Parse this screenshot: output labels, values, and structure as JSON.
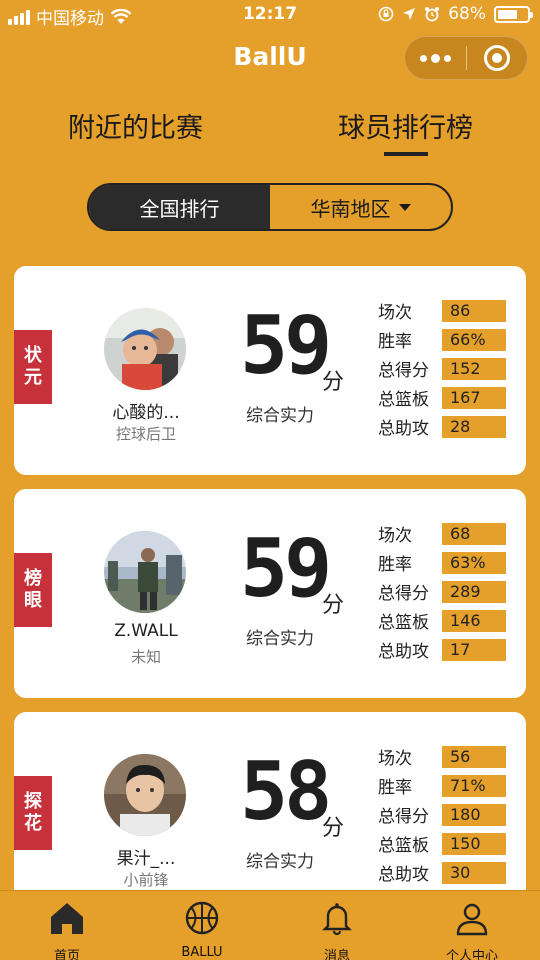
{
  "status_bar": {
    "carrier": "中国移动",
    "time": "12:17",
    "battery_percent": "68%",
    "battery_level": 0.68
  },
  "nav": {
    "title": "BallU"
  },
  "tabs": [
    {
      "label": "附近的比赛",
      "active": false
    },
    {
      "label": "球员排行榜",
      "active": true
    }
  ],
  "segment": {
    "national": "全国排行",
    "region": "华南地区"
  },
  "players": [
    {
      "ribbon": [
        "状",
        "元"
      ],
      "name": "心酸的...",
      "position": "控球后卫",
      "score": "59",
      "unit": "分",
      "score_label": "综合实力",
      "stats": [
        {
          "label": "场次",
          "value": "86"
        },
        {
          "label": "胜率",
          "value": "66%"
        },
        {
          "label": "总得分",
          "value": "152"
        },
        {
          "label": "总篮板",
          "value": "167"
        },
        {
          "label": "总助攻",
          "value": "28"
        }
      ]
    },
    {
      "ribbon": [
        "榜",
        "眼"
      ],
      "name": "Z.WALL",
      "position": "未知",
      "score": "59",
      "unit": "分",
      "score_label": "综合实力",
      "stats": [
        {
          "label": "场次",
          "value": "68"
        },
        {
          "label": "胜率",
          "value": "63%"
        },
        {
          "label": "总得分",
          "value": "289"
        },
        {
          "label": "总篮板",
          "value": "146"
        },
        {
          "label": "总助攻",
          "value": "17"
        }
      ]
    },
    {
      "ribbon": [
        "探",
        "花"
      ],
      "name": "果汁_...",
      "position": "小前锋",
      "score": "58",
      "unit": "分",
      "score_label": "综合实力",
      "stats": [
        {
          "label": "场次",
          "value": "56"
        },
        {
          "label": "胜率",
          "value": "71%"
        },
        {
          "label": "总得分",
          "value": "180"
        },
        {
          "label": "总篮板",
          "value": "150"
        },
        {
          "label": "总助攻",
          "value": "30"
        }
      ]
    }
  ],
  "bottom_nav": [
    {
      "label": "首页",
      "icon": "home-icon"
    },
    {
      "label": "BALLU",
      "icon": "basketball-icon"
    },
    {
      "label": "消息",
      "icon": "bell-icon"
    },
    {
      "label": "个人中心",
      "icon": "user-icon"
    }
  ],
  "colors": {
    "background": "#E5A02B",
    "ribbon": "#C7323A",
    "dark": "#2B2B2B",
    "card": "#FFFFFF"
  }
}
